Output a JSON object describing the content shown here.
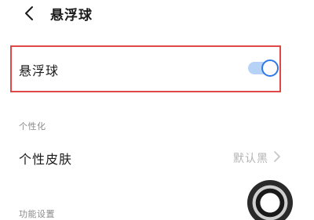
{
  "header": {
    "title": "悬浮球"
  },
  "floating_ball": {
    "label": "悬浮球",
    "enabled": true
  },
  "sections": {
    "personalization": {
      "title": "个性化",
      "skin": {
        "label": "个性皮肤",
        "value": "默认黑"
      }
    },
    "function_settings": {
      "title": "功能设置"
    }
  },
  "colors": {
    "accent": "#2f7ae5",
    "toggle_track": "#b7d2f7",
    "highlight_border": "#e04848"
  }
}
